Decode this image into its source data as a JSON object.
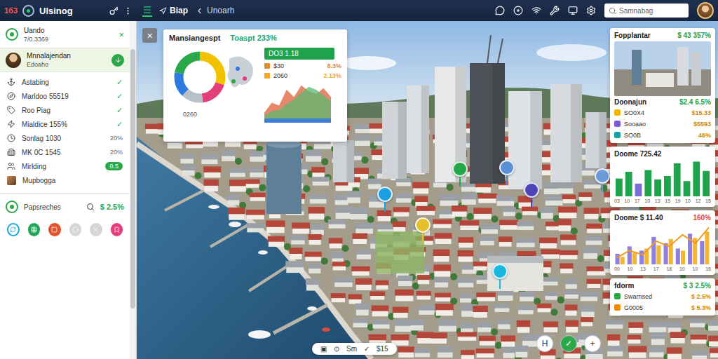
{
  "topbar": {
    "badge": "1б3",
    "brand": "Ulsinog",
    "nav": [
      {
        "label": "Biap",
        "selected": true
      },
      {
        "label": "Unoarh",
        "selected": false
      }
    ],
    "search": {
      "placeholder": "Samnabag"
    }
  },
  "sidebar": {
    "header": {
      "title": "Uando",
      "subtitle": "7/0.3369",
      "close": "×"
    },
    "active": {
      "title": "Mnnalajendan",
      "subtitle": "Edoaho",
      "selected": true
    },
    "items": [
      {
        "label": "Astabing",
        "kind": "check",
        "value": "✓"
      },
      {
        "label": "Marldoo 55519",
        "kind": "check",
        "value": "✓"
      },
      {
        "label": "Roo Piag",
        "kind": "check",
        "value": "✓"
      },
      {
        "label": "Mialdice 155%",
        "kind": "check",
        "value": "✓"
      },
      {
        "label": "Sonlag 1030",
        "kind": "text",
        "value": "20%"
      },
      {
        "label": "MK 0C 1545",
        "kind": "text",
        "value": "20%"
      },
      {
        "label": "Mirlding",
        "kind": "badge",
        "value": "0.5"
      },
      {
        "label": "Mupbogga",
        "kind": "avatar"
      }
    ],
    "footer": {
      "label": "Papsreches",
      "value": "$ 2.5%"
    },
    "actions": [
      {
        "kind": "ring",
        "color": "#1aa9d8"
      },
      {
        "kind": "fill",
        "color": "#23a455"
      },
      {
        "kind": "fill",
        "color": "#e0532f"
      },
      {
        "kind": "fill",
        "color": "#d4d6d8"
      },
      {
        "kind": "fill",
        "color": "#d4d6d8"
      },
      {
        "kind": "fill",
        "color": "#e23f7c"
      }
    ]
  },
  "map": {
    "pins": [
      {
        "color": "#22a84a"
      },
      {
        "color": "#5b8fd6"
      },
      {
        "color": "#1a9fe0"
      },
      {
        "color": "#4d45b8"
      },
      {
        "color": "#e6c02a"
      },
      {
        "color": "#1ab6e0"
      },
      {
        "color": "#6d9ad8"
      }
    ]
  },
  "overlay": {
    "close": "×",
    "title": "Mansiangespt",
    "headline": "Toaspt 233%",
    "donut": {
      "values": [
        30,
        18,
        14,
        16,
        22
      ],
      "colors": [
        "#f2c200",
        "#e2407a",
        "#b8c0c8",
        "#2d7be0",
        "#2aa84a"
      ]
    },
    "caption": "0260",
    "highlight": "DO3 1.18",
    "stats": [
      {
        "label": "$30",
        "value": "8.3%",
        "color": "#e08a2a"
      },
      {
        "label": "2060",
        "value": "2.13%",
        "color": "#f5a623"
      }
    ],
    "area": {
      "series": [
        {
          "values": [
            8,
            22,
            18,
            40,
            30,
            46,
            38,
            34,
            42,
            30
          ],
          "color": "#e0603a"
        },
        {
          "values": [
            4,
            10,
            12,
            20,
            26,
            36,
            44,
            40,
            32,
            24
          ],
          "color": "#5cb870"
        }
      ]
    }
  },
  "panels": {
    "summary": {
      "title": "Fopplantar",
      "value": "$ 43 357%",
      "trend": "up",
      "subtitle": "Doonajun",
      "subvalue": "$2.4 6.5%",
      "rows": [
        {
          "label": "SO0X4",
          "value": "$15.33",
          "color": "#f5b400"
        },
        {
          "label": "Sooaao",
          "value": "$5593",
          "color": "#7b5cd6"
        },
        {
          "label": "SO0B",
          "value": "46%",
          "color": "#19a0a0"
        }
      ]
    },
    "bars": {
      "title": "Doome 725.42",
      "values": [
        42,
        58,
        30,
        62,
        40,
        48,
        78,
        36,
        82,
        60
      ],
      "labels": [
        "03",
        "10",
        "17",
        "10",
        "13",
        "15",
        "19",
        "10",
        "12",
        "15"
      ]
    },
    "combo": {
      "title": "Doome $ 11.40",
      "value": "160%",
      "trend": "down",
      "bars": [
        {
          "values": [
            20,
            34,
            26,
            52,
            40,
            30,
            58,
            44
          ],
          "color": "#8f80e0"
        },
        {
          "values": [
            14,
            22,
            30,
            36,
            48,
            26,
            50,
            62
          ],
          "color": "#f2b630"
        }
      ],
      "line": {
        "values": [
          12,
          26,
          18,
          44,
          34,
          56,
          40,
          70
        ],
        "color": "#f09a20"
      },
      "labels": [
        "00",
        "10",
        "13",
        "17",
        "18",
        "10",
        "10",
        "16"
      ]
    },
    "list": {
      "title": "fdorm",
      "value": "$ 3 2.5%",
      "trend": "up",
      "rows": [
        {
          "label": "Swarnsed",
          "value": "$ 2.5%",
          "color": "#2aa84a"
        },
        {
          "label": "G0005",
          "value": "$ 5.3%",
          "color": "#f08c00"
        }
      ]
    }
  },
  "bottom": {
    "toolbar": [
      "▣",
      "⊙",
      "Sm",
      "✓",
      "$15"
    ],
    "buttons": [
      {
        "label": "H",
        "kind": "plain"
      },
      {
        "label": "✓",
        "kind": "accent"
      },
      {
        "label": "+",
        "kind": "plain"
      }
    ]
  }
}
